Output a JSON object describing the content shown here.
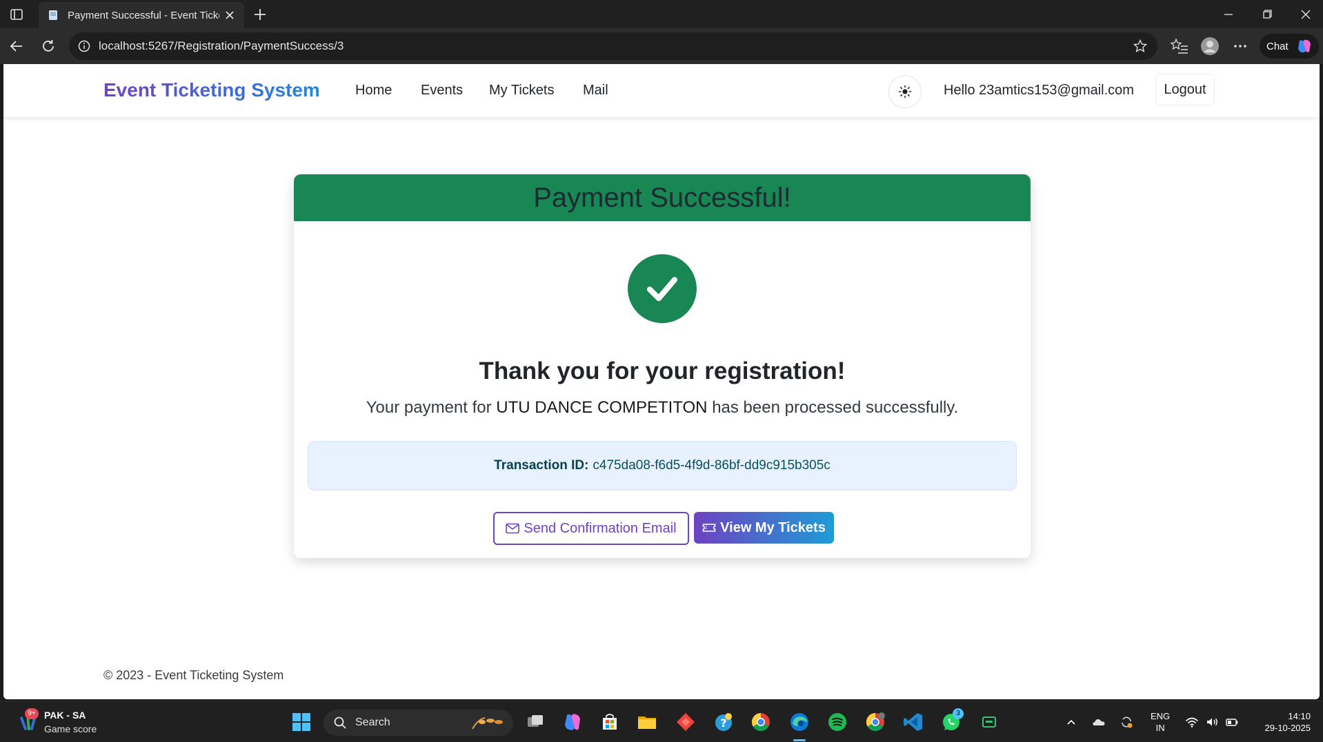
{
  "browser": {
    "tab_title": "Payment Successful - Event Ticketing System",
    "url": "localhost:5267/Registration/PaymentSuccess/3",
    "chat_label": "Chat"
  },
  "navbar": {
    "brand": "Event Ticketing System",
    "links": [
      "Home",
      "Events",
      "My Tickets",
      "Mail"
    ],
    "greeting": "Hello 23amtics153@gmail.com",
    "logout": "Logout"
  },
  "card": {
    "header": "Payment Successful!",
    "thanks": "Thank you for your registration!",
    "message_prefix": "Your payment for",
    "event_name": "UTU DANCE COMPETITON",
    "message_suffix": "has been processed successfully.",
    "transaction_label": "Transaction ID:",
    "transaction_id": "c475da08-f6d5-4f9d-86bf-dd9c915b305c",
    "send_email_label": "Send Confirmation Email",
    "view_tickets_label": "View My Tickets"
  },
  "footer": {
    "text": "© 2023 - Event Ticketing System"
  },
  "taskbar": {
    "widget_badge": "9+",
    "widget_title": "PAK - SA",
    "widget_subtitle": "Game score",
    "search_placeholder": "Search",
    "whatsapp_badge": "3",
    "language": "ENG",
    "region": "IN",
    "time": "14:10",
    "date": "29-10-2025"
  },
  "colors": {
    "success_green": "#198754",
    "brand_purple": "#6f42c1",
    "brand_blue": "#1e88e5",
    "info_bg": "#e7f1ff"
  }
}
